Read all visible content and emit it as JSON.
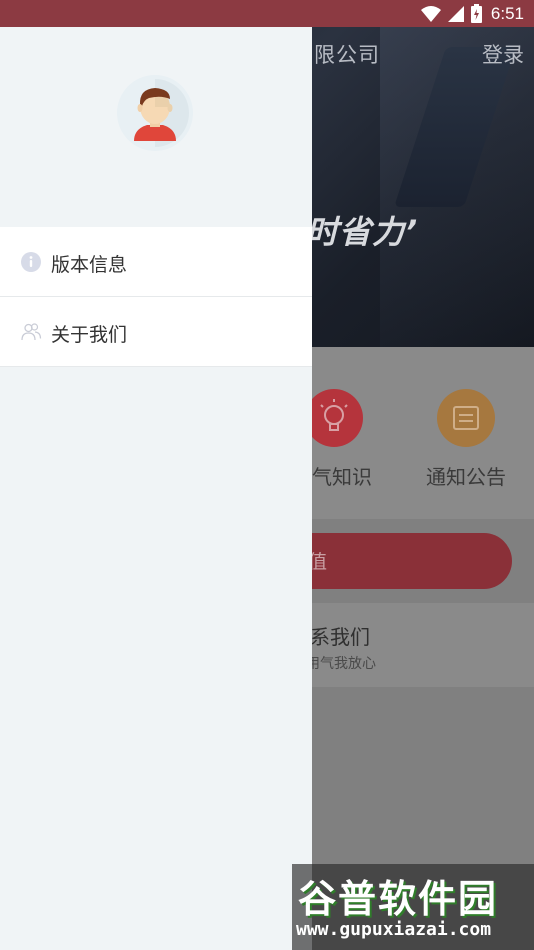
{
  "status_bar": {
    "time": "6:51",
    "icons": [
      "wifi-icon",
      "signal-icon",
      "battery-icon"
    ]
  },
  "background": {
    "company_partial": "限公司",
    "login_label": "登录",
    "slogan_partial": "时省力’",
    "functions": [
      {
        "label": "气知识",
        "icon": "lightbulb-icon",
        "color": "#b5343c"
      },
      {
        "label": "通知公告",
        "icon": "notice-icon",
        "color": "#a6783f"
      }
    ],
    "pill_button_partial": "值",
    "contact": {
      "title_partial": "系我们",
      "subtitle_partial": "用气我放心"
    }
  },
  "drawer": {
    "avatar_icon": "user-avatar-icon",
    "menu": [
      {
        "label": "版本信息",
        "icon": "info-icon"
      },
      {
        "label": "关于我们",
        "icon": "users-icon"
      }
    ]
  },
  "watermark": {
    "logo": "谷普软件园",
    "url": "www.gupuxiazai.com"
  },
  "colors": {
    "status_bar": "#8c3a42",
    "drawer_bg": "#f0f4f6",
    "accent_red": "#d9434c",
    "accent_orange": "#e39a46"
  }
}
